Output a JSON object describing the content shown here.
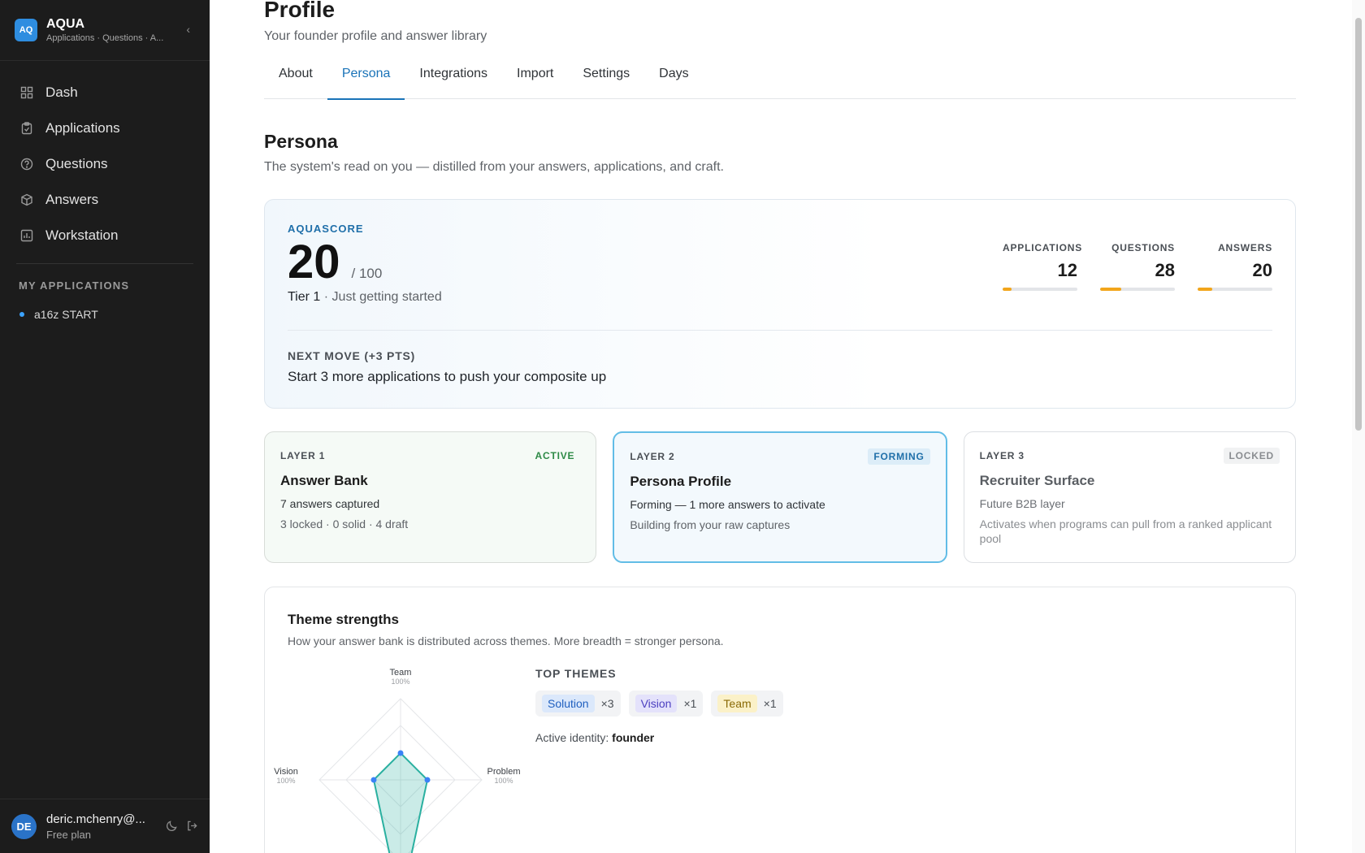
{
  "brand": {
    "logo": "AQ",
    "name": "AQUA",
    "subtitle": "Applications · Questions · A..."
  },
  "nav": [
    {
      "label": "Dash",
      "icon": "grid-icon"
    },
    {
      "label": "Applications",
      "icon": "clipboard-icon"
    },
    {
      "label": "Questions",
      "icon": "help-circle-icon"
    },
    {
      "label": "Answers",
      "icon": "box-icon"
    },
    {
      "label": "Workstation",
      "icon": "chart-icon"
    }
  ],
  "my_applications": {
    "title": "MY APPLICATIONS",
    "items": [
      "a16z START"
    ]
  },
  "user": {
    "initials": "DE",
    "email": "deric.mchenry@...",
    "plan": "Free plan"
  },
  "page": {
    "title": "Profile",
    "subtitle": "Your founder profile and answer library"
  },
  "tabs": [
    "About",
    "Persona",
    "Integrations",
    "Import",
    "Settings",
    "Days"
  ],
  "active_tab": "Persona",
  "persona": {
    "title": "Persona",
    "subtitle": "The system's read on you — distilled from your answers, applications, and craft."
  },
  "score": {
    "label": "AQUASCORE",
    "value": "20",
    "max": "/ 100",
    "tier": "Tier 1",
    "tier_desc": "· Just getting started",
    "stats": [
      {
        "label": "APPLICATIONS",
        "value": "12",
        "fill": 0.12
      },
      {
        "label": "QUESTIONS",
        "value": "28",
        "fill": 0.28
      },
      {
        "label": "ANSWERS",
        "value": "20",
        "fill": 0.2
      }
    ],
    "next_label": "NEXT MOVE (+3 PTS)",
    "next_text": "Start 3 more applications to push your composite up"
  },
  "layers": [
    {
      "tag": "LAYER 1",
      "badge": "ACTIVE",
      "title": "Answer Bank",
      "d1": "7 answers captured",
      "d2": "3 locked · 0 solid · 4 draft"
    },
    {
      "tag": "LAYER 2",
      "badge": "FORMING",
      "title": "Persona Profile",
      "d1": "Forming — 1 more answers to activate",
      "d2": "Building from your raw captures"
    },
    {
      "tag": "LAYER 3",
      "badge": "LOCKED",
      "title": "Recruiter Surface",
      "d1": "Future B2B layer",
      "d2": "Activates when programs can pull from a ranked applicant pool"
    }
  ],
  "themes": {
    "title": "Theme strengths",
    "subtitle": "How your answer bank is distributed across themes. More breadth = stronger persona.",
    "radar_labels": [
      {
        "name": "Team",
        "pct": "100%"
      },
      {
        "name": "Vision",
        "pct": "100%"
      },
      {
        "name": "Problem",
        "pct": "100%"
      }
    ],
    "top_label": "TOP THEMES",
    "chips": [
      {
        "name": "Solution",
        "count": "×3",
        "bg": "#dbe8fb",
        "fg": "#1f5fbf"
      },
      {
        "name": "Vision",
        "count": "×1",
        "bg": "#e4e2fb",
        "fg": "#4b3fc0"
      },
      {
        "name": "Team",
        "count": "×1",
        "bg": "#fbf1c8",
        "fg": "#8a6a06"
      }
    ],
    "identity_label": "Active identity:",
    "identity_value": "founder"
  },
  "colors": {
    "accent": "#1a73b8",
    "sidebar": "#1c1c1c",
    "progress": "#f2a51b",
    "radar": "#2ab0a0"
  }
}
